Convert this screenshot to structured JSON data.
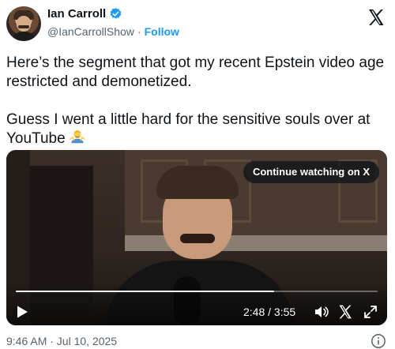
{
  "author": {
    "display_name": "Ian Carroll",
    "handle": "@IanCarrollShow",
    "separator": "·",
    "follow_label": "Follow",
    "verified_color": "#1d9bf0"
  },
  "tweet": {
    "text": "Here’s the segment that got my recent Epstein video age restricted and demonetized.\n\nGuess I went a little hard for the sensitive souls over at YouTube ",
    "emoji_icon": "person-shrugging-emoji",
    "timestamp": "9:46 AM · Jul 10, 2025"
  },
  "video": {
    "continue_label": "Continue watching on X",
    "time": "2:48 / 3:55",
    "progress_fraction": 0.715
  },
  "colors": {
    "text": "#0f1419",
    "secondary": "#536471",
    "link": "#1d9bf0"
  }
}
